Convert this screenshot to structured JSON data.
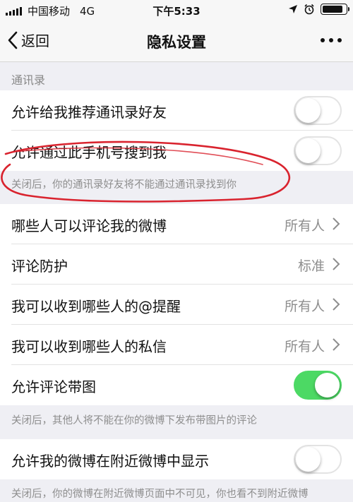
{
  "status_bar": {
    "carrier": "中国移动",
    "network": "4G",
    "time": "下午5:33",
    "battery_level_percent": 90
  },
  "nav": {
    "back_label": "返回",
    "title": "隐私设置",
    "more_icon": "more-dots-icon"
  },
  "sections": {
    "contacts_header": "通讯录"
  },
  "settings": {
    "recommend_contacts": {
      "label": "允许给我推荐通讯录好友",
      "enabled": false
    },
    "find_by_phone": {
      "label": "允许通过此手机号搜到我",
      "enabled": false
    },
    "contacts_note": "关闭后，你的通讯录好友将不能通过通讯录找到你",
    "who_can_comment": {
      "label": "哪些人可以评论我的微博",
      "value": "所有人"
    },
    "comment_protection": {
      "label": "评论防护",
      "value": "标准"
    },
    "mention_alerts": {
      "label": "我可以收到哪些人的@提醒",
      "value": "所有人"
    },
    "private_messages": {
      "label": "我可以收到哪些人的私信",
      "value": "所有人"
    },
    "comment_images": {
      "label": "允许评论带图",
      "enabled": true
    },
    "comment_images_note": "关闭后，其他人将不能在你的微博下发布带图片的评论",
    "nearby_display": {
      "label": "允许我的微博在附近微博中显示",
      "enabled": false
    },
    "nearby_note": "关闭后，你的微博在附近微博页面中不可见，你也看不到附近微博"
  },
  "colors": {
    "toggle_on": "#4cd964",
    "annotation": "#d9232e",
    "background": "#efeff4"
  }
}
